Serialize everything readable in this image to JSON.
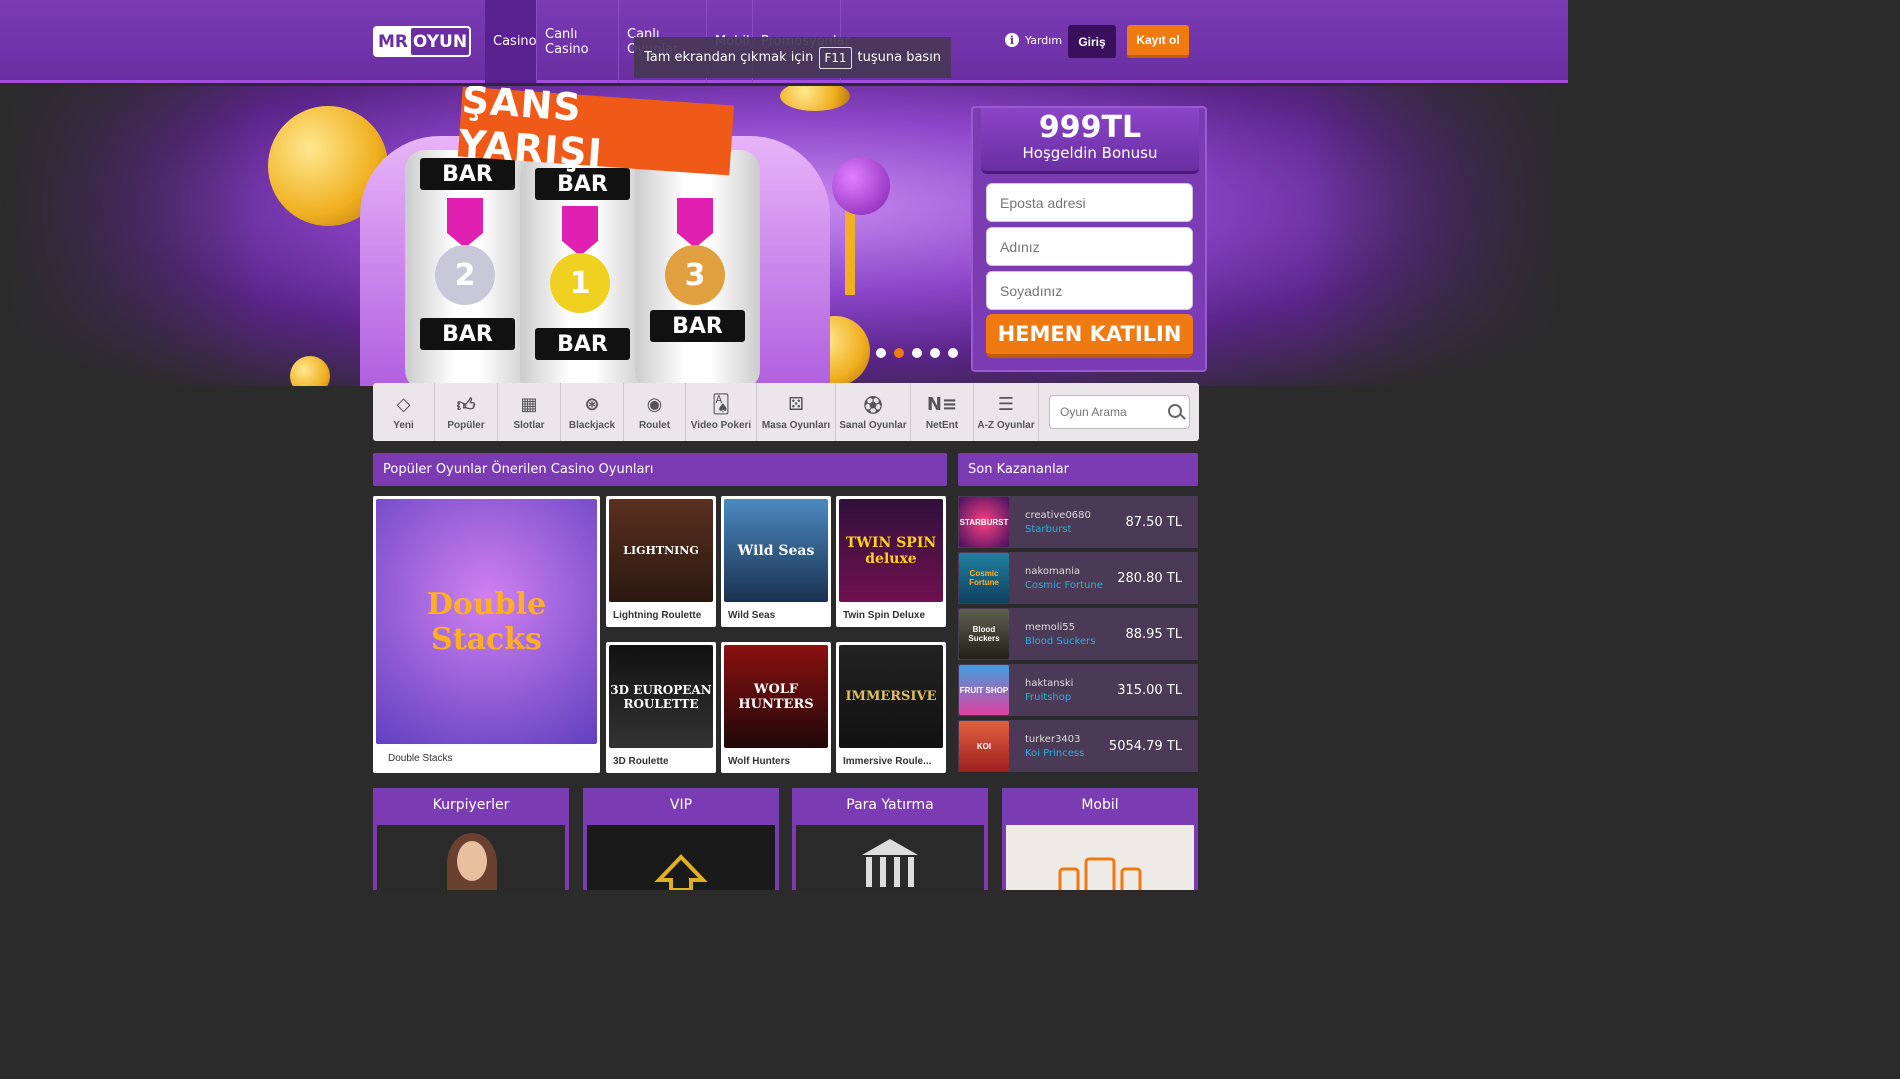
{
  "header": {
    "logo_mr": "MR",
    "logo_oyun": "OYUN",
    "nav": [
      "Casino",
      "Canlı Casino",
      "Canlı Oyunlar",
      "Mobil",
      "Promosyonlar"
    ],
    "help": "Yardım",
    "login": "Giriş",
    "register": "Kayıt ol"
  },
  "toast": {
    "before": "Tam ekrandan çıkmak için",
    "key": "F11",
    "after": "tuşuna basın"
  },
  "hero": {
    "banner_title": "ŞANS YARIŞI",
    "reel_label": "BAR",
    "medals": [
      "2",
      "1",
      "3"
    ],
    "dots": 5,
    "active_dot": 2
  },
  "signup": {
    "amount": "999TL",
    "subtitle": "Hoşgeldin Bonusu",
    "email_placeholder": "Eposta adresi",
    "first_name_placeholder": "Adınız",
    "last_name_placeholder": "Soyadınız",
    "cta": "HEMEN KATILIN"
  },
  "categories": [
    "Yeni",
    "Popüler",
    "Slotlar",
    "Blackjack",
    "Roulet",
    "Video Pokeri",
    "Masa Oyunları",
    "Sanal Oyunlar",
    "NetEnt",
    "A-Z Oyunlar"
  ],
  "search_placeholder": "Oyun Arama",
  "popular": {
    "title": "Popüler Oyunlar Önerilen Casino Oyunları",
    "featured": {
      "name": "Double Stacks",
      "art": "Double Stacks"
    },
    "games": [
      {
        "name": "Lightning Roulette",
        "art": "LIGHTNING"
      },
      {
        "name": "Wild Seas",
        "art": "Wild Seas"
      },
      {
        "name": "Twin Spin Deluxe",
        "art": "TWIN SPIN deluxe"
      },
      {
        "name": "3D Roulette",
        "art": "3D EUROPEAN ROULETTE"
      },
      {
        "name": "Wolf Hunters",
        "art": "WOLF HUNTERS"
      },
      {
        "name": "Immersive Roule...",
        "art": "IMMERSIVE"
      }
    ]
  },
  "winners": {
    "title": "Son Kazananlar",
    "rows": [
      {
        "user": "creative0680",
        "game": "Starburst",
        "amount": "87.50 TL",
        "art": "STARBURST"
      },
      {
        "user": "nakomania",
        "game": "Cosmic Fortune",
        "amount": "280.80 TL",
        "art": "Cosmic Fortune"
      },
      {
        "user": "memoli55",
        "game": "Blood Suckers",
        "amount": "88.95 TL",
        "art": "Blood Suckers"
      },
      {
        "user": "haktanski",
        "game": "Fruitshop",
        "amount": "315.00 TL",
        "art": "FRUIT SHOP"
      },
      {
        "user": "turker3403",
        "game": "Koi Princess",
        "amount": "5054.79 TL",
        "art": "KOI"
      }
    ]
  },
  "cards": [
    "Kurpiyerler",
    "VIP",
    "Para Yatırma",
    "Mobil"
  ],
  "colors": {
    "purple": "#7a3bb3",
    "orange": "#f07a12",
    "dark_bg": "#2b2b2b",
    "link_blue": "#2ab0e0"
  }
}
